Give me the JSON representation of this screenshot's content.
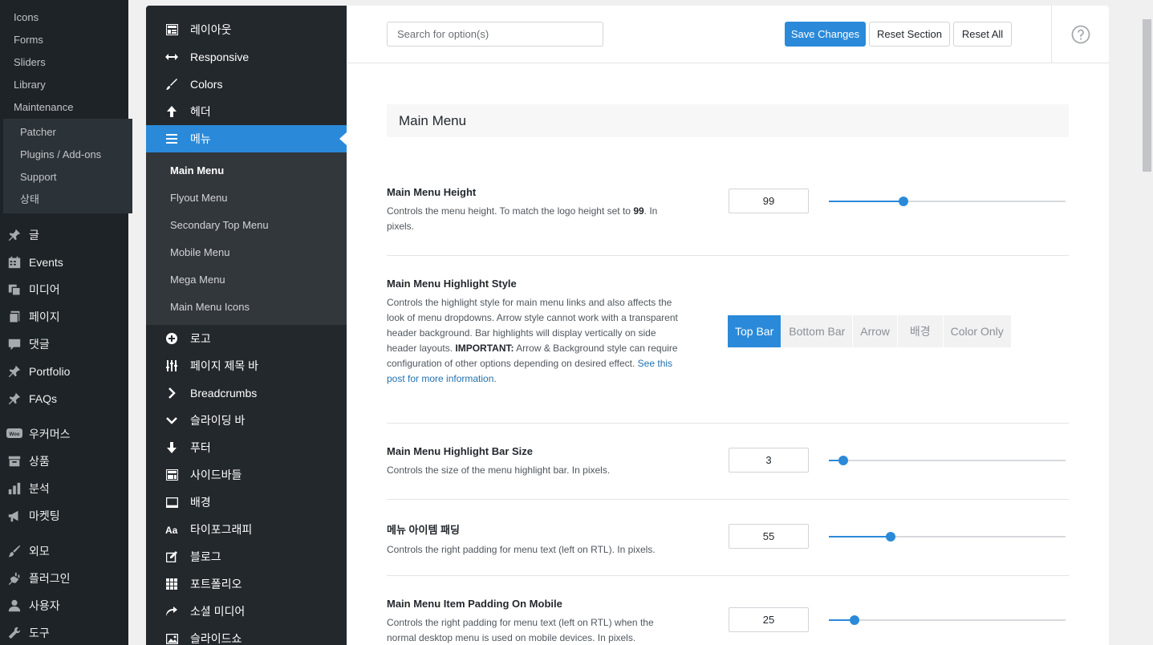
{
  "wp_sidebar": {
    "top_subitems": [
      "Icons",
      "Forms",
      "Sliders",
      "Library",
      "Maintenance"
    ],
    "flyout": [
      "Patcher",
      "Plugins / Add-ons",
      "Support",
      "상태"
    ],
    "items": [
      {
        "label": "글",
        "icon": "pin-icon"
      },
      {
        "label": "Events",
        "icon": "calendar-icon"
      },
      {
        "label": "미디어",
        "icon": "media-icon"
      },
      {
        "label": "페이지",
        "icon": "page-icon"
      },
      {
        "label": "댓글",
        "icon": "comment-icon"
      },
      {
        "label": "Portfolio",
        "icon": "pin-icon"
      },
      {
        "label": "FAQs",
        "icon": "pin-icon"
      },
      {
        "label": "우커머스",
        "icon": "woo-icon"
      },
      {
        "label": "상품",
        "icon": "archive-icon"
      },
      {
        "label": "분석",
        "icon": "bar-chart-icon"
      },
      {
        "label": "마켓팅",
        "icon": "megaphone-icon"
      },
      {
        "label": "외모",
        "icon": "brush-icon"
      },
      {
        "label": "플러그인",
        "icon": "plug-icon"
      },
      {
        "label": "사용자",
        "icon": "user-icon"
      },
      {
        "label": "도구",
        "icon": "wrench-icon"
      }
    ]
  },
  "options_nav": {
    "items_before": [
      {
        "label": "레이아웃",
        "icon": "layout-icon"
      },
      {
        "label": "Responsive",
        "icon": "arrows-horizontal-icon"
      },
      {
        "label": "Colors",
        "icon": "brush-icon"
      },
      {
        "label": "헤더",
        "icon": "arrow-up-icon"
      }
    ],
    "active": {
      "label": "메뉴",
      "icon": "hamburger-icon"
    },
    "submenu": [
      "Main Menu",
      "Flyout Menu",
      "Secondary Top Menu",
      "Mobile Menu",
      "Mega Menu",
      "Main Menu Icons"
    ],
    "items_after": [
      {
        "label": "로고",
        "icon": "plus-circle-icon"
      },
      {
        "label": "페이지 제목 바",
        "icon": "sliders-icon"
      },
      {
        "label": "Breadcrumbs",
        "icon": "chevron-right-icon"
      },
      {
        "label": "슬라이딩 바",
        "icon": "chevron-down-icon"
      },
      {
        "label": "푸터",
        "icon": "arrow-down-icon"
      },
      {
        "label": "사이드바들",
        "icon": "sidebar-icon"
      },
      {
        "label": "배경",
        "icon": "monitor-icon"
      },
      {
        "label": "타이포그래피",
        "icon": "typography-icon"
      },
      {
        "label": "블로그",
        "icon": "edit-icon"
      },
      {
        "label": "포트폴리오",
        "icon": "grid-icon"
      },
      {
        "label": "소셜 미디어",
        "icon": "share-icon"
      },
      {
        "label": "슬라이드쇼",
        "icon": "image-icon"
      }
    ]
  },
  "toolbar": {
    "search_placeholder": "Search for option(s)",
    "save_label": "Save Changes",
    "reset_section_label": "Reset Section",
    "reset_all_label": "Reset All",
    "help_icon": "question-circle-icon"
  },
  "section": {
    "title": "Main Menu",
    "options": [
      {
        "title": "Main Menu Height",
        "desc_before": "Controls the menu height. To match the logo height set to ",
        "desc_bold": "99",
        "desc_after": ". In pixels.",
        "value": "99",
        "slider_fraction": 0.315
      },
      {
        "title": "Main Menu Highlight Style",
        "desc_before": "Controls the highlight style for main menu links and also affects the look of menu dropdowns. Arrow style cannot work with a transparent header background. Bar highlights will display vertically on side header layouts. ",
        "desc_bold": "IMPORTANT:",
        "desc_after": " Arrow & Background style can require configuration of other options depending on desired effect. ",
        "link": "See this post for more information",
        "link_after": ".",
        "choices": [
          "Top Bar",
          "Bottom Bar",
          "Arrow",
          "배경",
          "Color Only"
        ],
        "selected": "Top Bar"
      },
      {
        "title": "Main Menu Highlight Bar Size",
        "desc": "Controls the size of the menu highlight bar. In pixels.",
        "value": "3",
        "slider_fraction": 0.06
      },
      {
        "title": "메뉴 아이템 패딩",
        "desc": "Controls the right padding for menu text (left on RTL). In pixels.",
        "value": "55",
        "slider_fraction": 0.26
      },
      {
        "title": "Main Menu Item Padding On Mobile",
        "desc": "Controls the right padding for menu text (left on RTL) when the normal desktop menu is used on mobile devices. In pixels.",
        "value": "25",
        "slider_fraction": 0.11
      }
    ]
  },
  "colors": {
    "accent": "#2a8ad9",
    "admin_bg": "#1d2327",
    "nav_bg": "#23282d"
  }
}
